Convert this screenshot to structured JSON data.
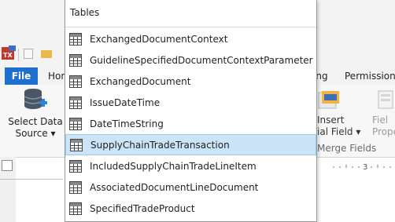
{
  "ribbon": {
    "tabs": [
      {
        "label": "File"
      },
      {
        "label": "Hon"
      },
      {
        "label": "ing"
      },
      {
        "label": "Permissions"
      }
    ],
    "select_data_source": {
      "line1": "Select Data",
      "line2": "Source",
      "arrow": "▾"
    },
    "insert_field": {
      "line1": "Insert",
      "line2": "ial Field",
      "arrow": "▾"
    },
    "field_properties": {
      "line1": "Fiel",
      "line2": "Proper"
    },
    "group_label": "Merge Fields"
  },
  "ruler": {
    "mark": "3"
  },
  "dropdown": {
    "title": "Tables",
    "items": [
      {
        "label": "ExchangedDocumentContext",
        "selected": false
      },
      {
        "label": "GuidelineSpecifiedDocumentContextParameter",
        "selected": false
      },
      {
        "label": "ExchangedDocument",
        "selected": false
      },
      {
        "label": "IssueDateTime",
        "selected": false
      },
      {
        "label": "DateTimeString",
        "selected": false
      },
      {
        "label": "SupplyChainTradeTransaction",
        "selected": true
      },
      {
        "label": "IncludedSupplyChainTradeLineItem",
        "selected": false
      },
      {
        "label": "AssociatedDocumentLineDocument",
        "selected": false
      },
      {
        "label": "SpecifiedTradeProduct",
        "selected": false
      }
    ]
  },
  "colors": {
    "file_tab": "#1f6fcf",
    "selection_bg": "#cce4f7",
    "selection_border": "#99c9ef"
  }
}
